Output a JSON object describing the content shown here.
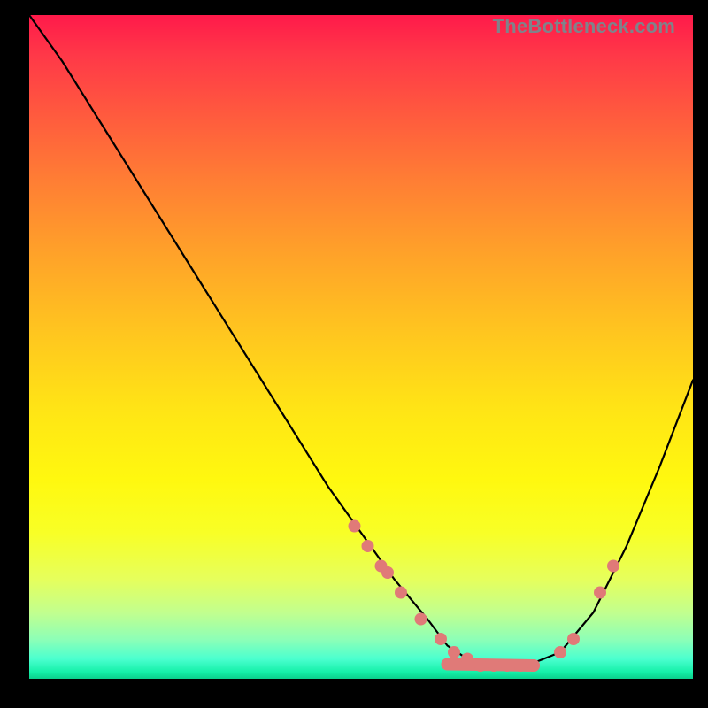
{
  "watermark": "TheBottleneck.com",
  "chart_data": {
    "type": "line",
    "title": "",
    "xlabel": "",
    "ylabel": "",
    "xlim": [
      0,
      100
    ],
    "ylim": [
      0,
      100
    ],
    "grid": false,
    "series": [
      {
        "name": "curve",
        "x": [
          0,
          5,
          10,
          15,
          20,
          25,
          30,
          35,
          40,
          45,
          50,
          55,
          60,
          63,
          66,
          70,
          75,
          80,
          85,
          90,
          95,
          100
        ],
        "y": [
          100,
          93,
          85,
          77,
          69,
          61,
          53,
          45,
          37,
          29,
          22,
          15,
          9,
          5,
          3,
          2,
          2,
          4,
          10,
          20,
          32,
          45
        ]
      }
    ],
    "highlight_points": {
      "comment": "salmon dots on the curve",
      "x": [
        49,
        51,
        53,
        54,
        56,
        59,
        62,
        64,
        66,
        68,
        70,
        72,
        74,
        76,
        80,
        82,
        86,
        88
      ],
      "y": [
        23,
        20,
        17,
        16,
        13,
        9,
        6,
        4,
        3,
        2,
        2,
        2,
        2,
        2,
        4,
        6,
        13,
        17
      ]
    }
  }
}
